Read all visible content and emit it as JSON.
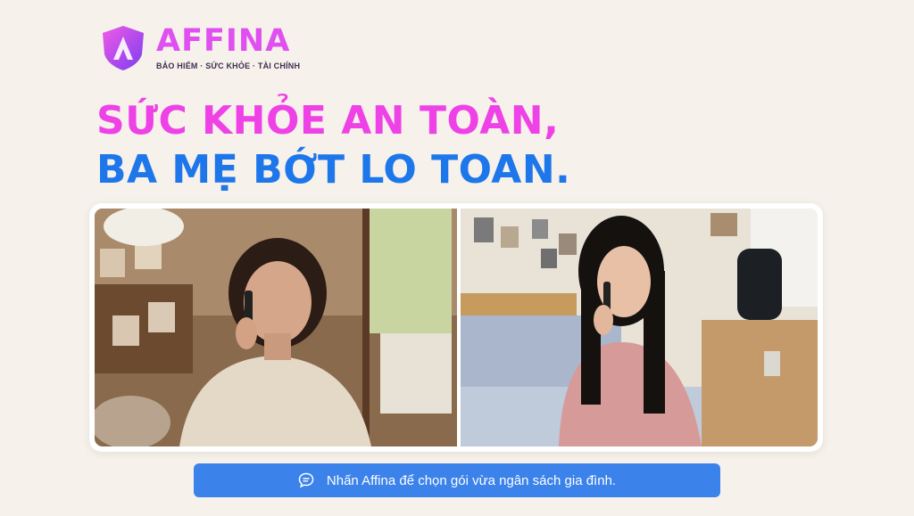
{
  "brand": {
    "name": "AFFINA",
    "tagline": "BẢO HIỂM · SỨC KHỎE · TÀI CHÍNH"
  },
  "headline": {
    "line1": "SỨC KHỎE AN TOÀN,",
    "line2": "BA MẸ BỚT LO TOAN."
  },
  "photos": {
    "left_icon": "mother-on-phone-image",
    "right_icon": "daughter-on-phone-image"
  },
  "cta": {
    "label": "Nhấn Affina để chọn gói vừa ngân sách gia đình.",
    "icon": "chat-bubble-icon"
  },
  "colors": {
    "background": "#f6f1eb",
    "brand_pink": "#ee42e6",
    "brand_blue": "#1d76ea",
    "cta_blue": "#3b82ea"
  }
}
